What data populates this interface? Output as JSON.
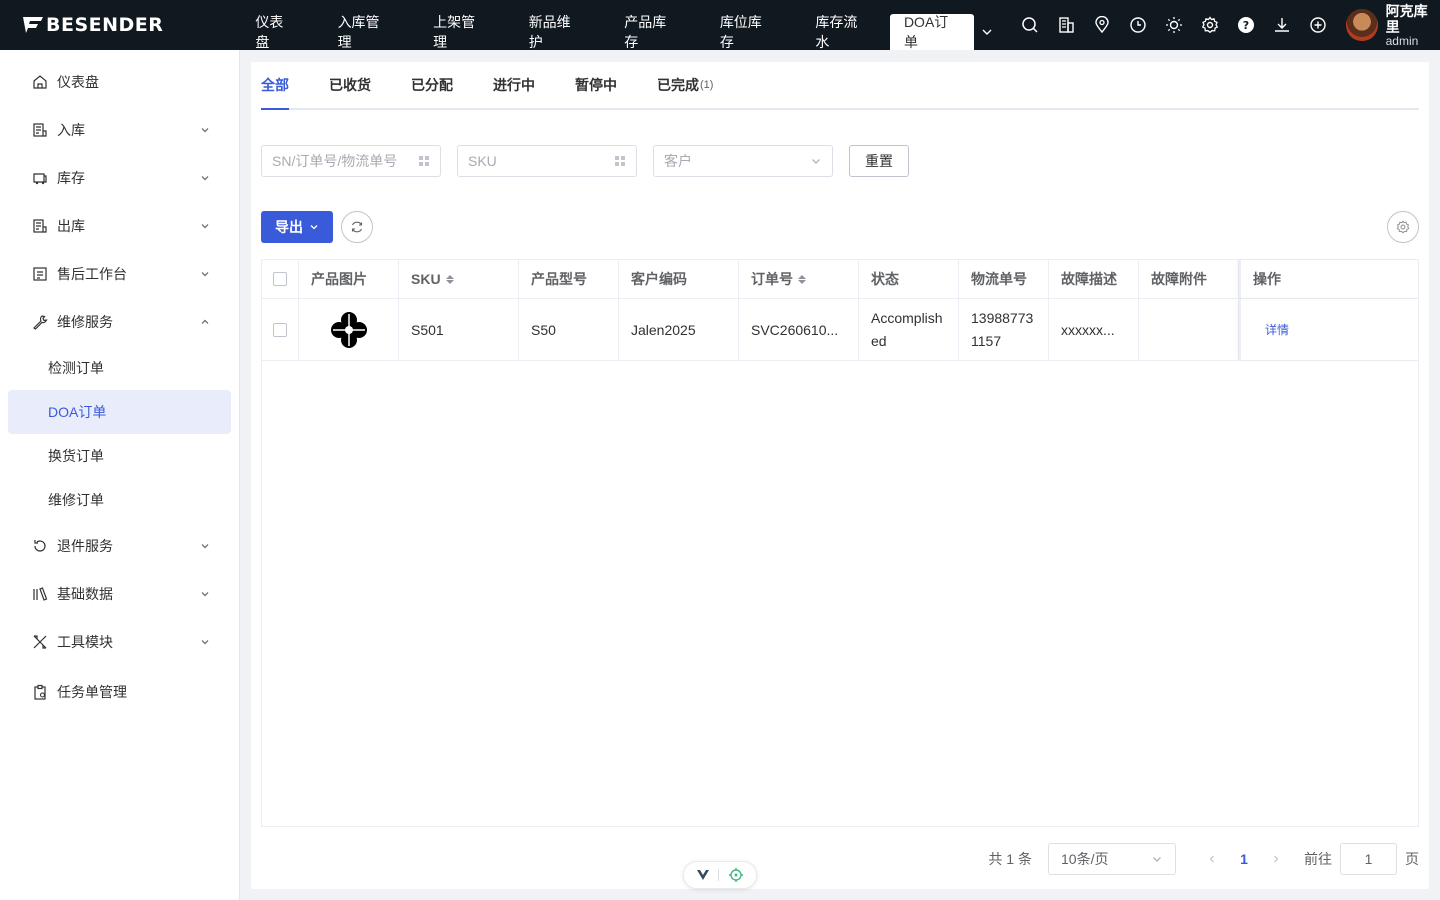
{
  "brand": {
    "name": "BESENDER"
  },
  "topnav": {
    "items": [
      {
        "label": "仪表盘"
      },
      {
        "label": "入库管理"
      },
      {
        "label": "上架管理"
      },
      {
        "label": "新品维护"
      },
      {
        "label": "产品库存"
      },
      {
        "label": "库位库存"
      },
      {
        "label": "库存流水"
      },
      {
        "label": "DOA订单"
      }
    ],
    "active": "DOA订单",
    "icons": [
      "search-icon",
      "building-icon",
      "location-icon",
      "clock-icon",
      "sun-icon",
      "gear-icon",
      "help-icon",
      "download-icon",
      "plus-circle-icon"
    ]
  },
  "user": {
    "name": "阿克库里",
    "role": "admin"
  },
  "sidebar": {
    "items": [
      {
        "label": "仪表盘",
        "icon": "home-icon"
      },
      {
        "label": "入库",
        "icon": "inbound-icon"
      },
      {
        "label": "库存",
        "icon": "inventory-icon"
      },
      {
        "label": "出库",
        "icon": "outbound-icon"
      },
      {
        "label": "售后工作台",
        "icon": "after-sales-icon"
      },
      {
        "label": "维修服务",
        "icon": "wrench-icon"
      },
      {
        "label": "退件服务",
        "icon": "return-icon"
      },
      {
        "label": "基础数据",
        "icon": "database-icon"
      },
      {
        "label": "工具模块",
        "icon": "tools-icon"
      },
      {
        "label": "任务单管理",
        "icon": "task-icon"
      }
    ],
    "sub_items": [
      {
        "label": "检测订单"
      },
      {
        "label": "DOA订单"
      },
      {
        "label": "换货订单"
      },
      {
        "label": "维修订单"
      }
    ],
    "active_sub": "DOA订单"
  },
  "tabs": [
    {
      "label": "全部"
    },
    {
      "label": "已收货"
    },
    {
      "label": "已分配"
    },
    {
      "label": "进行中"
    },
    {
      "label": "暂停中"
    },
    {
      "label": "已完成",
      "count": "(1)"
    }
  ],
  "filters": {
    "sn_placeholder": "SN/订单号/物流单号",
    "sku_placeholder": "SKU",
    "customer_placeholder": "客户",
    "reset_label": "重置"
  },
  "toolbar": {
    "export_label": "导出"
  },
  "table": {
    "columns": [
      "产品图片",
      "SKU",
      "产品型号",
      "客户编码",
      "订单号",
      "状态",
      "物流单号",
      "故障描述",
      "故障附件",
      "操作"
    ],
    "rows": [
      {
        "sku": "S501",
        "model": "S50",
        "customer_code": "Jalen2025",
        "order_no": "SVC260610...",
        "status": "Accomplished",
        "tracking_no": "13988773 1157",
        "fault_desc": "xxxxxx...",
        "fault_attachment": "",
        "action": "详情"
      }
    ]
  },
  "pagination": {
    "total": "共 1 条",
    "page_size": "10条/页",
    "current": "1",
    "goto_label": "前往",
    "goto_value": "1",
    "page_suffix": "页"
  },
  "colors": {
    "primary": "#3a5bd9",
    "topbar": "#101820"
  }
}
